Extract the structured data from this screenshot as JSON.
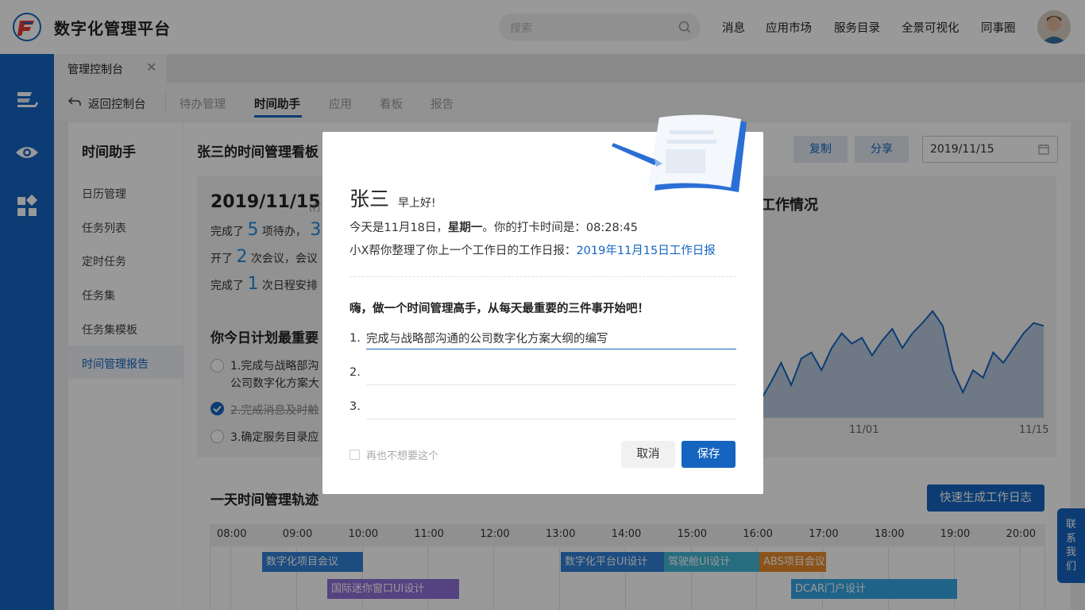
{
  "header": {
    "app_title": "数字化管理平台",
    "search_placeholder": "搜索",
    "nav": [
      "消息",
      "应用市场",
      "服务目录",
      "全景可视化",
      "同事圈"
    ]
  },
  "tabs": {
    "active_label": "管理控制台",
    "close": "✕"
  },
  "subnav": {
    "back_label": "返回控制台",
    "items": [
      "待办管理",
      "时间助手",
      "应用",
      "看板",
      "报告"
    ],
    "active": "时间助手"
  },
  "left_menu": {
    "title": "时间助手",
    "items": [
      "日历管理",
      "任务列表",
      "定时任务",
      "任务集",
      "任务集模板",
      "时间管理报告"
    ],
    "active": "时间管理报告"
  },
  "board": {
    "title": "张三的时间管理看板",
    "copy_label": "复制",
    "share_label": "分享",
    "date_value": "2019/11/15"
  },
  "stats": {
    "date": "2019/11/15",
    "date_note": "(打",
    "line1_a": "完成了",
    "line1_num": "5",
    "line1_b": "项待办，",
    "line1_num2": "3",
    "line2_a": "开了",
    "line2_num": "2",
    "line2_b": "次会议，会议",
    "line3_a": "完成了",
    "line3_num": "1",
    "line3_b": "次日程安排",
    "plan_title": "你今日计划最重要",
    "plan1_a": "1.完成与战略部沟",
    "plan1_b": "公司数字化方案大",
    "plan2": "2.完成消息及时触",
    "plan3": "3.确定服务目录应"
  },
  "chart_data": {
    "type": "area",
    "title": "工作情况",
    "x_ticks": [
      "11/01",
      "11/15"
    ],
    "series": [
      {
        "values": [
          0.1,
          0.22,
          0.35,
          0.2,
          0.38,
          0.42,
          0.3,
          0.45,
          0.55,
          0.48,
          0.52,
          0.4,
          0.5,
          0.58,
          0.45,
          0.55,
          0.62,
          0.7,
          0.6,
          0.3,
          0.15,
          0.3,
          0.25,
          0.42,
          0.35,
          0.45,
          0.55,
          0.62,
          0.6
        ]
      }
    ]
  },
  "timeline": {
    "title": "一天时间管理轨迹",
    "generate_label": "快速生成工作日志",
    "hours": [
      "08:00",
      "09:00",
      "10:00",
      "11:00",
      "12:00",
      "13:00",
      "14:00",
      "15:00",
      "16:00",
      "17:00",
      "18:00",
      "19:00",
      "20:00"
    ],
    "events": [
      {
        "label": "数字化项目会议",
        "color": "#2f7fd6"
      },
      {
        "label": "国际迷你窗口UI设计",
        "color": "#8e6fd8"
      },
      {
        "label": "数字化平台UI设计",
        "color": "#2f7fd6"
      },
      {
        "label": "驾驶舱UI设计",
        "color": "#43b5d6"
      },
      {
        "label": "ABS项目会议",
        "color": "#e88a2c"
      },
      {
        "label": "DCAR门户设计",
        "color": "#36a6e4"
      }
    ]
  },
  "contact_label": "联系我们",
  "modal": {
    "name": "张三",
    "greeting": "早上好!",
    "line1_a": "今天是11月18日，",
    "line1_bold": "星期一",
    "line1_b": "。你的打卡时间是：",
    "line1_time": "08:28:45",
    "line2_a": "小X帮你整理了你上一个工作日的工作日报：",
    "line2_link": "2019年11月15日工作日报",
    "prompt": "嗨，做一个时间管理高手，从每天最重要的三件事开始吧！",
    "items": [
      {
        "num": "1.",
        "value": "完成与战略部沟通的公司数字化方案大纲的编写"
      },
      {
        "num": "2.",
        "value": ""
      },
      {
        "num": "3.",
        "value": ""
      }
    ],
    "dont_show_label": "再也不想要这个",
    "cancel_label": "取消",
    "save_label": "保存"
  }
}
